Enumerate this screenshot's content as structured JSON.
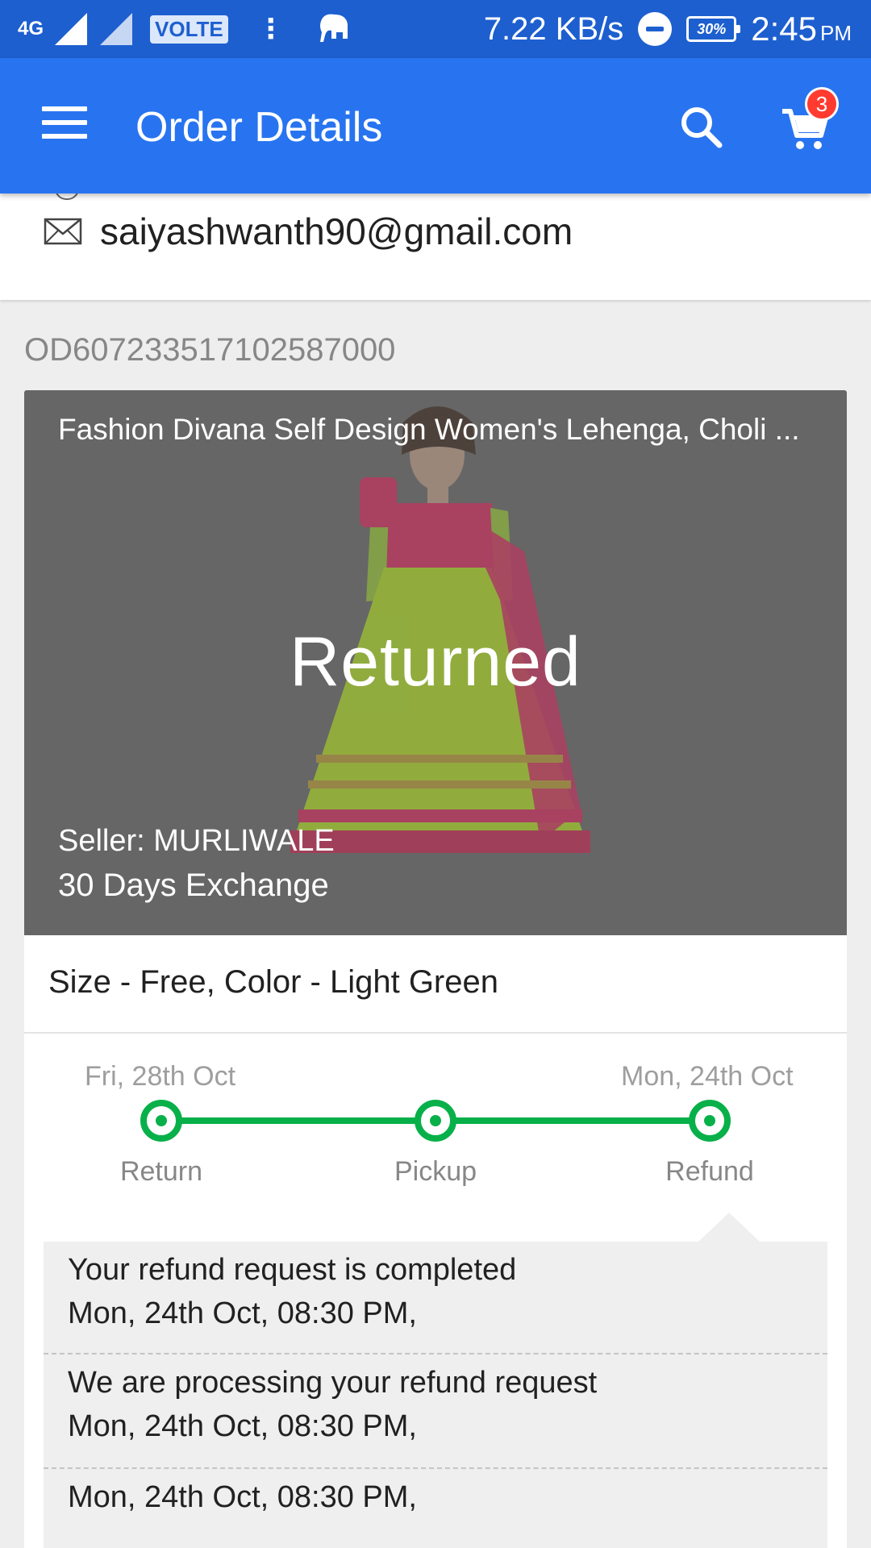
{
  "status_bar": {
    "network": "4G",
    "sim1": "1",
    "sim2": "2",
    "volte": "VOLTE",
    "speed": "7.22 KB/s",
    "battery": "30%",
    "time": "2:45",
    "ampm": "PM"
  },
  "app_bar": {
    "title": "Order Details",
    "cart_count": "3",
    "bg_color": "#2874f0"
  },
  "contact": {
    "email": "saiyashwanth90@gmail.com"
  },
  "order": {
    "id": "OD607233517102587000"
  },
  "product": {
    "title": "Fashion Divana Self Design Women's Lehenga, Choli ...",
    "status": "Returned",
    "seller": "Seller: MURLIWALE",
    "exchange": "30 Days Exchange",
    "variant": "Size - Free, Color - Light Green"
  },
  "tracker": {
    "start_date": "Fri, 28th Oct",
    "end_date": "Mon, 24th Oct",
    "steps": [
      "Return",
      "Pickup",
      "Refund"
    ],
    "accent_color": "#08b04a"
  },
  "events": [
    {
      "text": "Your refund request is completed",
      "time": "Mon, 24th Oct, 08:30 PM,"
    },
    {
      "text": "We are processing your refund request",
      "time": "Mon, 24th Oct, 08:30 PM,"
    },
    {
      "text": "",
      "time": "Mon, 24th Oct, 08:30 PM,"
    }
  ]
}
